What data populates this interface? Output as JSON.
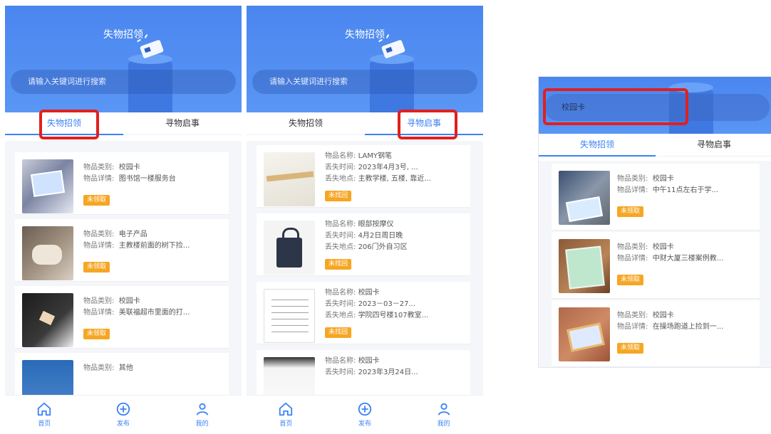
{
  "app": {
    "title": "失物招领",
    "search_placeholder": "请输入关键词进行搜索",
    "tabs": [
      "失物招领",
      "寻物启事"
    ],
    "nav": [
      {
        "label": "首页",
        "icon": "home-icon"
      },
      {
        "label": "发布",
        "icon": "plus-circle-icon"
      },
      {
        "label": "我的",
        "icon": "user-icon"
      }
    ]
  },
  "screen1": {
    "active_tab": 0,
    "items": [
      {
        "k1": "物品类别:",
        "v1": "校园卡",
        "k2": "物品详情:",
        "v2": "图书馆一楼服务台",
        "badge": "未领取"
      },
      {
        "k1": "物品类别:",
        "v1": "电子产品",
        "k2": "物品详情:",
        "v2": "主教楼前面的树下捡...",
        "badge": "未领取"
      },
      {
        "k1": "物品类别:",
        "v1": "校园卡",
        "k2": "物品详情:",
        "v2": "美联福超市里面的打...",
        "badge": "未领取"
      },
      {
        "k1": "物品类别:",
        "v1": "其他"
      }
    ]
  },
  "screen2": {
    "active_tab": 1,
    "items": [
      {
        "k1": "物品名称:",
        "v1": "LAMY钢笔",
        "k2": "丢失时间:",
        "v2": "2023年4月3号, ...",
        "k3": "丢失地点:",
        "v3": "主教学楼, 五楼, 靠近...",
        "badge": "未找回"
      },
      {
        "k1": "物品名称:",
        "v1": "眼部按摩仪",
        "k2": "丢失时间:",
        "v2": "4月2日周日晚",
        "k3": "丢失地点:",
        "v3": "206门外自习区",
        "badge": "未找回"
      },
      {
        "k1": "物品名称:",
        "v1": "校园卡",
        "k2": "丢失时间:",
        "v2": "2023－03－27...",
        "k3": "丢失地点:",
        "v3": "学院四号楼107教室...",
        "badge": "未找回"
      },
      {
        "k1": "物品名称:",
        "v1": "校园卡",
        "k2": "丢失时间:",
        "v2": "2023年3月24日..."
      }
    ]
  },
  "screen3": {
    "search_value": "校园卡",
    "active_tab": 0,
    "items": [
      {
        "k1": "物品类别:",
        "v1": "校园卡",
        "k2": "物品详情:",
        "v2": "中午11点左右于学...",
        "badge": "未领取"
      },
      {
        "k1": "物品类别:",
        "v1": "校园卡",
        "k2": "物品详情:",
        "v2": "中财大厦三楼案例教...",
        "badge": "未领取"
      },
      {
        "k1": "物品类别:",
        "v1": "校园卡",
        "k2": "物品详情:",
        "v2": "在操场跑道上捡到一...",
        "badge": "未领取"
      }
    ]
  },
  "colors": {
    "primary": "#3b82f6",
    "badge": "#f6a623",
    "highlight": "#e02020"
  }
}
